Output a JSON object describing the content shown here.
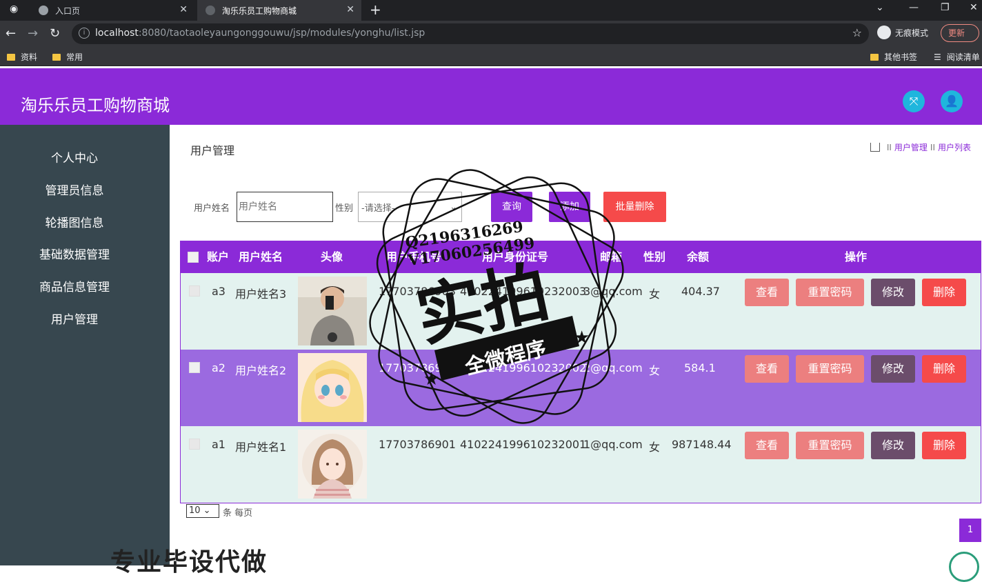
{
  "browser": {
    "tabs": [
      {
        "title": "入口页",
        "active": false
      },
      {
        "title": "淘乐乐员工购物商城",
        "active": true
      }
    ],
    "url_host": "localhost",
    "url_path": ":8080/taotaoleyaungonggouwu/jsp/modules/yonghu/list.jsp",
    "incognito_label": "无痕模式",
    "update_label": "更新",
    "bookmarks": [
      "资料",
      "常用"
    ],
    "bookmarks_right": [
      "其他书签",
      "阅读清单"
    ]
  },
  "header": {
    "title": "淘乐乐员工购物商城",
    "accent_color": "#8b2ad8"
  },
  "sidebar": {
    "items": [
      {
        "label": "个人中心"
      },
      {
        "label": "管理员信息"
      },
      {
        "label": "轮播图信息"
      },
      {
        "label": "基础数据管理"
      },
      {
        "label": "商品信息管理"
      },
      {
        "label": "用户管理"
      }
    ]
  },
  "page": {
    "heading": "用户管理",
    "breadcrumb": [
      "用户管理",
      "用户列表"
    ]
  },
  "search": {
    "name_label": "用户姓名",
    "name_placeholder": "用户姓名",
    "gender_label": "性别",
    "gender_value": "-请选择-",
    "query_label": "查询",
    "add_label": "添加",
    "batch_delete_label": "批量删除"
  },
  "table": {
    "columns": [
      "账户",
      "用户姓名",
      "头像",
      "用户手机号",
      "用户身份证号",
      "邮箱",
      "性别",
      "余额",
      "操作"
    ],
    "rows": [
      {
        "account": "a3",
        "name": "用户姓名3",
        "phone": "17703786903",
        "id_card": "410224199610232003",
        "email": "3@qq.com",
        "gender": "女",
        "balance": "404.37"
      },
      {
        "account": "a2",
        "name": "用户姓名2",
        "phone": "17703786902",
        "id_card": "410224199610232002",
        "email": "2@qq.com",
        "gender": "女",
        "balance": "584.1"
      },
      {
        "account": "a1",
        "name": "用户姓名1",
        "phone": "17703786901",
        "id_card": "410224199610232001",
        "email": "1@qq.com",
        "gender": "女",
        "balance": "987148.44"
      }
    ],
    "actions": {
      "view": "查看",
      "reset": "重置密码",
      "edit": "修改",
      "delete": "删除"
    }
  },
  "pager": {
    "page_size": "10",
    "page_size_text": "条 每页",
    "current_page": "1"
  },
  "watermark": {
    "qq": "Q2196316269",
    "wx": "V17060256499",
    "big": "实拍",
    "ribbon": "全微程序"
  },
  "overlay": {
    "bottom_text": "专业毕设代做"
  }
}
